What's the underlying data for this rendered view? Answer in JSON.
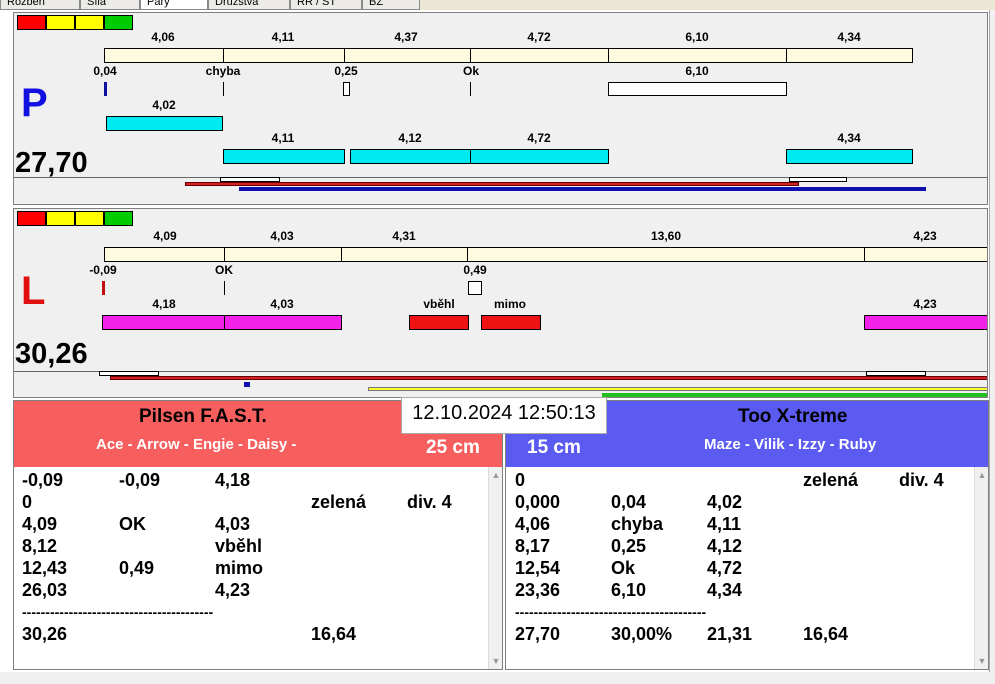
{
  "window": {
    "tabs": [
      "Rozběh",
      "Síla",
      "Páry",
      "Družstva",
      "RR / ST",
      "BZ"
    ],
    "active_tab_index": 2
  },
  "lanes": {
    "P": {
      "label": "P",
      "label_color": "#1010e0",
      "total": "27,70",
      "lamp_colors": [
        "#ff0000",
        "#ffff00",
        "#ffff00",
        "#00cc00"
      ],
      "top_row": [
        "4,06",
        "4,11",
        "4,37",
        "4,72",
        "6,10",
        "4,34"
      ],
      "mid_row": [
        "0,04",
        "chyba",
        "0,25",
        "Ok",
        "6,10"
      ],
      "team1_row": [
        "4,02"
      ],
      "team2_row": [
        "4,11",
        "4,12",
        "4,72",
        "4,34"
      ]
    },
    "L": {
      "label": "L",
      "label_color": "#e01010",
      "total": "30,26",
      "lamp_colors": [
        "#ff0000",
        "#ffff00",
        "#ffff00",
        "#00cc00"
      ],
      "top_row": [
        "4,09",
        "4,03",
        "4,31",
        "13,60",
        "4,23"
      ],
      "mid_row": [
        "-0,09",
        "OK",
        "0,49"
      ],
      "team_row": [
        "4,18",
        "4,03",
        "vběhl",
        "mimo",
        "4,23"
      ]
    }
  },
  "datetime": "12.10.2024 12:50:13",
  "team_left": {
    "name": "Pilsen F.A.S.T.",
    "dogs": "Ace - Arrow - Engie - Daisy -",
    "height": "25 cm",
    "color": "#f75f5f",
    "rows": [
      [
        "-0,09",
        "-0,09",
        "4,18",
        "",
        ""
      ],
      [
        "0",
        "",
        "",
        "zelená",
        "div. 4"
      ],
      [
        "4,09",
        "OK",
        "4,03",
        "",
        ""
      ],
      [
        "8,12",
        "",
        "vběhl",
        "",
        ""
      ],
      [
        "12,43",
        "0,49",
        "mimo",
        "",
        ""
      ],
      [
        "26,03",
        "",
        "4,23",
        "",
        ""
      ]
    ],
    "separator": "-----------------------------------------",
    "summary": [
      "30,26",
      "",
      "",
      "16,64",
      ""
    ]
  },
  "team_right": {
    "name": "Too X-treme",
    "dogs": "Maze - Vilik - Izzy - Ruby",
    "height": "15 cm",
    "color": "#5b5bf2",
    "rows": [
      [
        "0",
        "",
        "",
        "zelená",
        "div. 4"
      ],
      [
        "0,000",
        "0,04",
        "4,02",
        "",
        ""
      ],
      [
        "4,06",
        "chyba",
        "4,11",
        "",
        ""
      ],
      [
        "8,17",
        "0,25",
        "4,12",
        "",
        ""
      ],
      [
        "12,54",
        "Ok",
        "4,72",
        "",
        ""
      ],
      [
        "23,36",
        "6,10",
        "4,34",
        "",
        ""
      ]
    ],
    "separator": "-----------------------------------------",
    "summary": [
      "27,70",
      "30,00%",
      "21,31",
      "16,64",
      ""
    ]
  }
}
